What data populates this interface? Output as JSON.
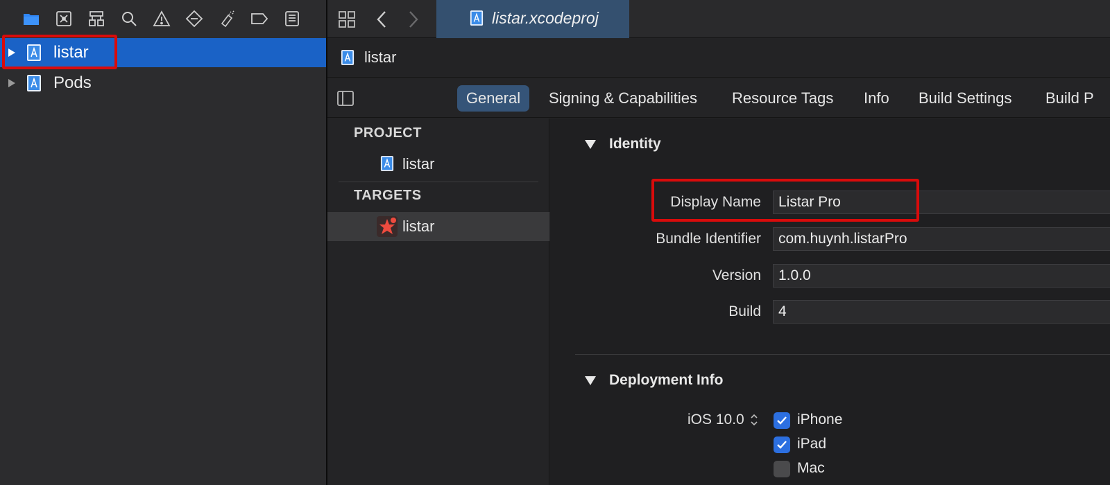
{
  "navigator": {
    "toolbar_icons": [
      "folder-icon",
      "source-control-icon",
      "hierarchy-icon",
      "search-icon",
      "warning-icon",
      "breakpoint-icon",
      "test-icon",
      "tag-icon",
      "report-icon"
    ],
    "tree": [
      {
        "label": "listar",
        "selected": true
      },
      {
        "label": "Pods",
        "selected": false
      }
    ]
  },
  "tabbar": {
    "active_tab": "listar.xcodeproj"
  },
  "jumpbar": {
    "item": "listar"
  },
  "editor_tabs": [
    "General",
    "Signing & Capabilities",
    "Resource Tags",
    "Info",
    "Build Settings",
    "Build P"
  ],
  "outline": {
    "project_header": "PROJECT",
    "project_item": "listar",
    "targets_header": "TARGETS",
    "target_item": "listar"
  },
  "identity": {
    "title": "Identity",
    "fields": [
      {
        "label": "Display Name",
        "value": "Listar Pro"
      },
      {
        "label": "Bundle Identifier",
        "value": "com.huynh.listarPro"
      },
      {
        "label": "Version",
        "value": "1.0.0"
      },
      {
        "label": "Build",
        "value": "4"
      }
    ]
  },
  "deployment": {
    "title": "Deployment Info",
    "ios_version": "iOS 10.0",
    "devices": [
      {
        "label": "iPhone",
        "checked": true
      },
      {
        "label": "iPad",
        "checked": true
      },
      {
        "label": "Mac",
        "checked": false
      }
    ]
  },
  "colors": {
    "selection": "#1a62c6",
    "highlight": "#d90b0b",
    "tab_active": "#34506f",
    "checkbox": "#2c6fe0"
  }
}
